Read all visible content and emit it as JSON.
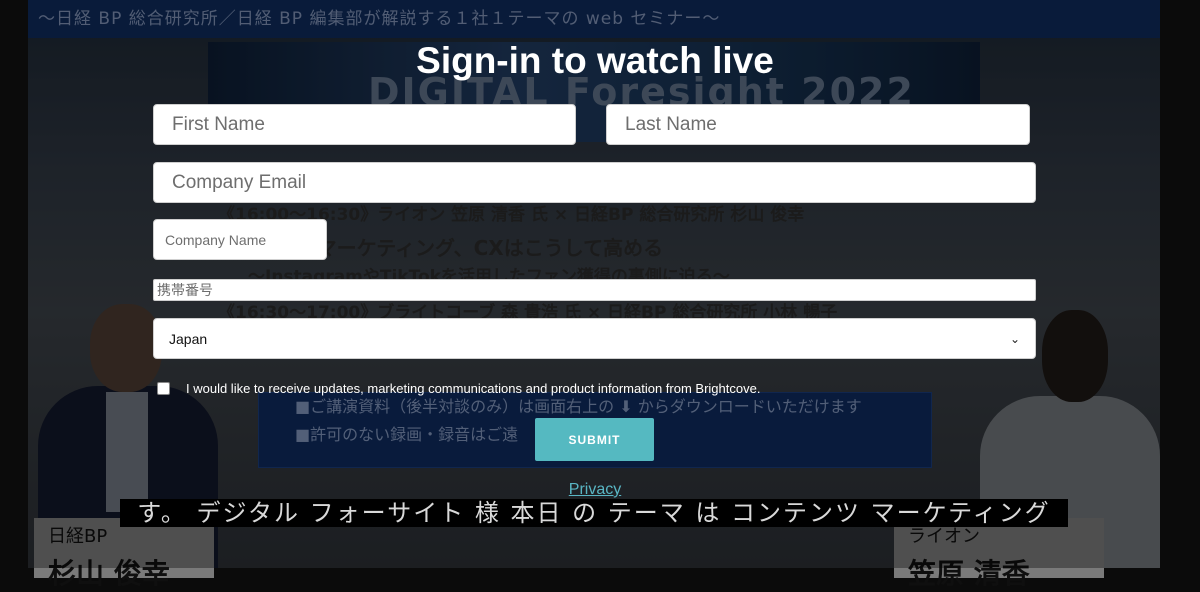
{
  "background": {
    "header_text": "〜日経 BP 総合研究所／日経 BP 編集部が解説する１社１テーマの web セミナー〜",
    "banner_text": "DIGITAL Foresight 2022",
    "lines": [
      "《16:00〜16:30》ライオン 笠原 清香 氏 × 日経BP 総合研究所 杉山 俊幸",
      "変えるマーケティング、CXはこうして高める",
      "〜InstagramやTikTokを活用したファン獲得の裏側に迫る〜",
      "《16:30〜17:00》ブライトコーブ 森 貴浩 氏 × 日経BP 総合研究所 小林 暢子"
    ],
    "notice_lines": [
      "■ご講演資料（後半対談のみ）は画面右上の ⬇ からダウンロードいただけます",
      "■許可のない録画・録音はご遠"
    ],
    "nameplate_left": {
      "org": "日経BP",
      "name": "杉山 俊幸"
    },
    "nameplate_right": {
      "org": "ライオン",
      "name": "笠原 清香"
    },
    "caption": "す。 デジタル フォーサイト 様 本日 の テーマ は コンテンツ マーケティング"
  },
  "form": {
    "title": "Sign-in to watch live",
    "first_name_placeholder": "First Name",
    "last_name_placeholder": "Last Name",
    "email_placeholder": "Company Email",
    "company_placeholder": "Company Name",
    "mobile_placeholder": "携帯番号",
    "country_value": "Japan",
    "consent_checked": false,
    "consent_label": "I would like to receive updates, marketing communications and product information from Brightcove.",
    "submit_label": "SUBMIT",
    "privacy_label": "Privacy"
  },
  "colors": {
    "accent": "#55b9c1",
    "link": "#59b6c4"
  }
}
